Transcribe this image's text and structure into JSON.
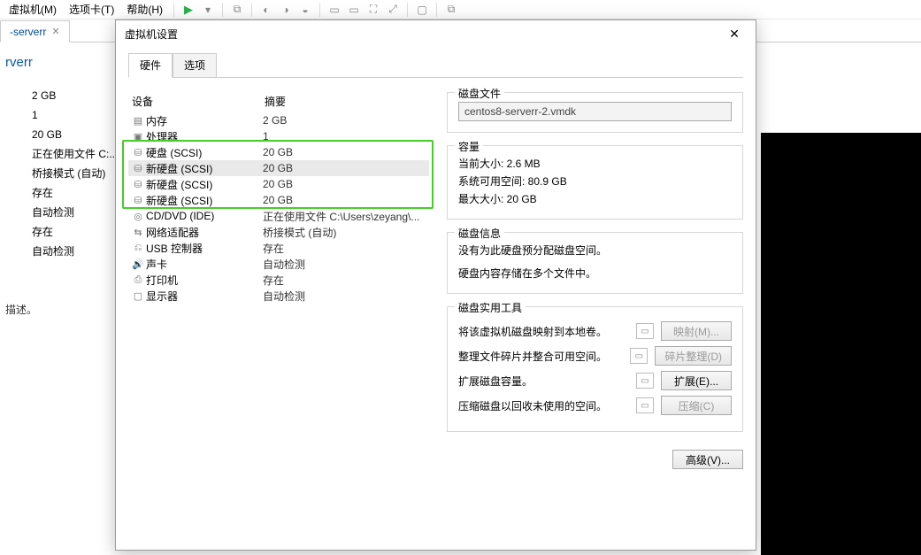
{
  "menubar": {
    "vm": "虚拟机(M)",
    "tabs": "选项卡(T)",
    "help": "帮助(H)"
  },
  "tabstrip": {
    "tab1": "-serverr"
  },
  "main": {
    "title": "rverr",
    "side": [
      "2 GB",
      "1",
      "20 GB",
      "正在使用文件 C:...",
      "桥接模式 (自动)",
      "存在",
      "自动检测",
      "存在",
      "自动检测"
    ],
    "desc": "描述。"
  },
  "dialog": {
    "title": "虚拟机设置",
    "tabs": {
      "hardware": "硬件",
      "options": "选项"
    },
    "cols": {
      "device": "设备",
      "summary": "摘要"
    },
    "rows": [
      {
        "icon": "mem",
        "name": "内存",
        "sum": "2 GB"
      },
      {
        "icon": "cpu",
        "name": "处理器",
        "sum": "1"
      },
      {
        "icon": "hdd",
        "name": "硬盘 (SCSI)",
        "sum": "20 GB"
      },
      {
        "icon": "hdd",
        "name": "新硬盘 (SCSI)",
        "sum": "20 GB",
        "sel": true
      },
      {
        "icon": "hdd",
        "name": "新硬盘 (SCSI)",
        "sum": "20 GB"
      },
      {
        "icon": "hdd",
        "name": "新硬盘 (SCSI)",
        "sum": "20 GB"
      },
      {
        "icon": "cd",
        "name": "CD/DVD (IDE)",
        "sum": "正在使用文件 C:\\Users\\zeyang\\..."
      },
      {
        "icon": "net",
        "name": "网络适配器",
        "sum": "桥接模式 (自动)"
      },
      {
        "icon": "usb",
        "name": "USB 控制器",
        "sum": "存在"
      },
      {
        "icon": "snd",
        "name": "声卡",
        "sum": "自动检测"
      },
      {
        "icon": "prn",
        "name": "打印机",
        "sum": "存在"
      },
      {
        "icon": "dsp",
        "name": "显示器",
        "sum": "自动检测"
      }
    ],
    "file": {
      "legend": "磁盘文件",
      "value": "centos8-serverr-2.vmdk"
    },
    "capacity": {
      "legend": "容量",
      "cur": "当前大小: 2.6 MB",
      "free": "系统可用空间: 80.9 GB",
      "max": "最大大小: 20 GB"
    },
    "info": {
      "legend": "磁盘信息",
      "l1": "没有为此硬盘预分配磁盘空间。",
      "l2": "硬盘内容存储在多个文件中。"
    },
    "util": {
      "legend": "磁盘实用工具",
      "map_t": "将该虚拟机磁盘映射到本地卷。",
      "map_b": "映射(M)...",
      "defrag_t": "整理文件碎片并整合可用空间。",
      "defrag_b": "碎片整理(D)",
      "expand_t": "扩展磁盘容量。",
      "expand_b": "扩展(E)...",
      "compact_t": "压缩磁盘以回收未使用的空间。",
      "compact_b": "压缩(C)"
    },
    "advanced": "高级(V)..."
  }
}
